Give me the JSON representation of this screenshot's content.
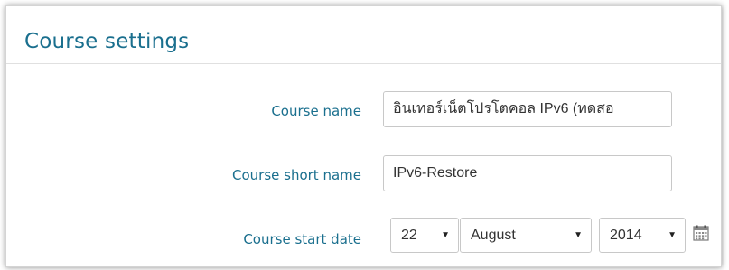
{
  "legend": "Course settings",
  "fields": {
    "fullname": {
      "label": "Course name",
      "value": "อินเทอร์เน็ตโปรโตคอล IPv6 (ทดสอ"
    },
    "shortname": {
      "label": "Course short name",
      "value": "IPv6-Restore"
    },
    "startdate": {
      "label": "Course start date",
      "day": "22",
      "month": "August",
      "year": "2014"
    }
  },
  "icons": {
    "calendar": "calendar-icon",
    "dropdown": "chevron-down-icon"
  },
  "colors": {
    "accent": "#1a6f8e",
    "border": "#c8c8c8"
  },
  "glyphs": {
    "caret": "▼"
  }
}
